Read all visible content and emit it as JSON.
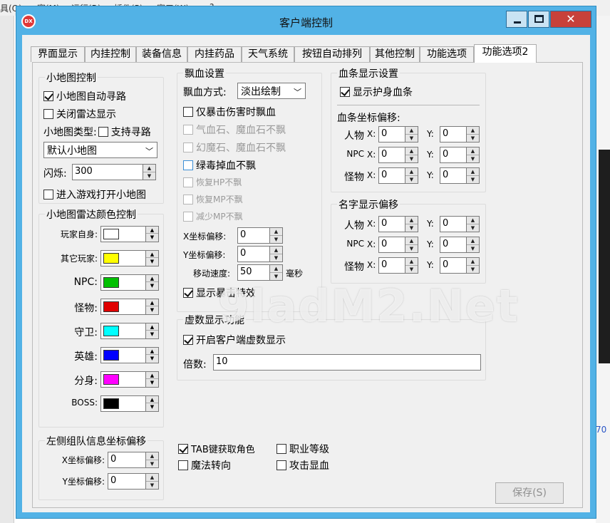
{
  "background_app": {
    "menu": [
      "具(Q)",
      "窗(M)",
      "运行(R)",
      "插件(P)",
      "窗口(W)",
      "?"
    ],
    "right_text": "70"
  },
  "window": {
    "title": "客户端控制",
    "icon_label": "DX",
    "close_glyph": "✕"
  },
  "tabs": [
    "界面显示",
    "内挂控制",
    "装备信息",
    "内挂药品",
    "天气系统",
    "按钮自动排列",
    "其他控制",
    "功能选项",
    "功能选项2"
  ],
  "minimap": {
    "title": "小地图控制",
    "auto_path": "小地图自动寻路",
    "close_radar": "关闭雷达显示",
    "type_label": "小地图类型:",
    "support_path": "支持寻路",
    "type_value": "默认小地图",
    "flash_label": "闪烁:",
    "flash_value": "300",
    "open_on_enter": "进入游戏打开小地图"
  },
  "radar_colors": {
    "title": "小地图雷达颜色控制",
    "items": [
      {
        "label": "玩家自身:",
        "color": "#ffffff"
      },
      {
        "label": "其它玩家:",
        "color": "#ffff00"
      },
      {
        "label": "NPC:",
        "color": "#00c000"
      },
      {
        "label": "怪物:",
        "color": "#e00000"
      },
      {
        "label": "守卫:",
        "color": "#00ffff"
      },
      {
        "label": "英雄:",
        "color": "#0000ff"
      },
      {
        "label": "分身:",
        "color": "#ff00ff"
      },
      {
        "label": "BOSS:",
        "color": "#000000"
      }
    ]
  },
  "team_offset": {
    "title": "左侧组队信息坐标偏移",
    "x_label": "X坐标偏移:",
    "x_value": "0",
    "y_label": "Y坐标偏移:",
    "y_value": "0"
  },
  "float_blood": {
    "title": "飘血设置",
    "mode_label": "飘血方式:",
    "mode_value": "淡出绘制",
    "crit_only": "仅暴击伤害时飘血",
    "hp_stone": "气血石、魔血石不飘",
    "illusion_stone": "幻魔石、魔血石不飘",
    "poison_drop": "绿毒掉血不飘",
    "restore_hp": "恢复HP不飘",
    "restore_mp": "恢复MP不飘",
    "reduce_mp": "减少MP不飘",
    "x_offset_label": "X坐标偏移:",
    "x_offset_value": "0",
    "y_offset_label": "Y坐标偏移:",
    "y_offset_value": "0",
    "speed_label": "移动速度:",
    "speed_value": "50",
    "speed_unit": "毫秒",
    "show_crit_fx": "显示暴击特效"
  },
  "hp_bar": {
    "title": "血条显示设置",
    "show_guard_hp": "显示护身血条",
    "offset_title": "血条坐标偏移:",
    "rows": [
      {
        "label": "人物",
        "x": "0",
        "y": "0"
      },
      {
        "label": "NPC",
        "x": "0",
        "y": "0"
      },
      {
        "label": "怪物",
        "x": "0",
        "y": "0"
      }
    ],
    "x_label": "X:",
    "y_label": "Y:"
  },
  "name_offset": {
    "title": "名字显示偏移",
    "rows": [
      {
        "label": "人物",
        "x": "0",
        "y": "0"
      },
      {
        "label": "NPC",
        "x": "0",
        "y": "0"
      },
      {
        "label": "怪物",
        "x": "0",
        "y": "0"
      }
    ],
    "x_label": "X:",
    "y_label": "Y:"
  },
  "virtual_number": {
    "title": "虚数显示功能",
    "enable": "开启客户端虚数显示",
    "multiplier_label": "倍数:",
    "multiplier_value": "10"
  },
  "bottom_options": {
    "tab_select": "TAB键获取角色",
    "job_level": "职业等级",
    "magic_turn": "魔法转向",
    "attack_hp": "攻击显血"
  },
  "save_button": "保存(S)",
  "watermark": "9ladM2.Net"
}
